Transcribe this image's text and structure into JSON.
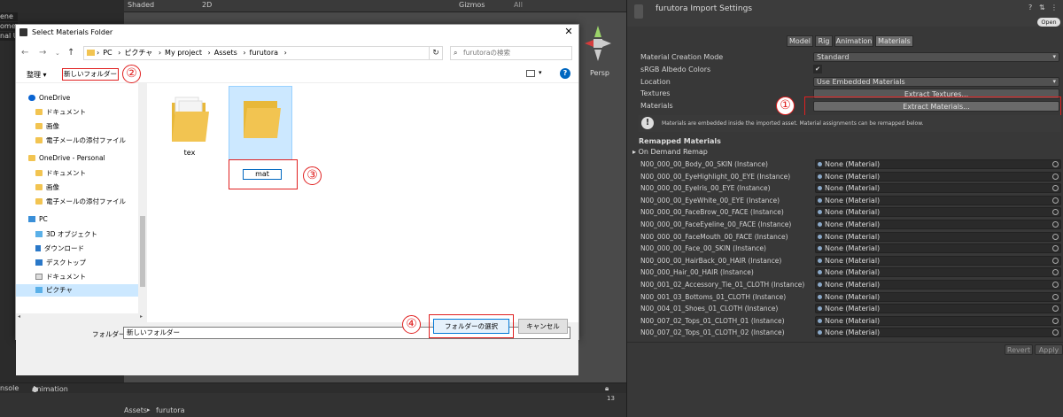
{
  "editor": {
    "hierarchy_fragments": [
      "ene",
      "omen",
      "nal U"
    ],
    "scene_toolbar": {
      "shading": "Shaded",
      "mode_2d": "2D",
      "gizmos": "Gizmos",
      "search_placeholder": "All"
    },
    "scene_persp": "Persp",
    "bottom_tabs": {
      "console": "nsole",
      "animation": "Animation"
    },
    "breadcrumb": {
      "root": "Assets",
      "sep": "▸",
      "folder": "furutora"
    },
    "layer_count": "13"
  },
  "inspector": {
    "title": "furutora Import Settings",
    "open_button": "Open",
    "tabs": [
      {
        "label": "Model",
        "active": false
      },
      {
        "label": "Rig",
        "active": false
      },
      {
        "label": "Animation",
        "active": false
      },
      {
        "label": "Materials",
        "active": true
      }
    ],
    "rows": {
      "creation_mode_label": "Material Creation Mode",
      "creation_mode_value": "Standard",
      "srgb_label": "sRGB Albedo Colors",
      "srgb_check": "✔",
      "location_label": "Location",
      "location_value": "Use Embedded Materials",
      "textures_label": "Textures",
      "textures_button": "Extract Textures...",
      "materials_label": "Materials",
      "materials_button": "Extract Materials..."
    },
    "info_text": "Materials are embedded inside the imported asset. Material assignments can be remapped below.",
    "remapped_header": "Remapped Materials",
    "on_demand": "On Demand Remap",
    "remap_value": "None (Material)",
    "remap_items": [
      "N00_000_00_Body_00_SKIN (Instance)",
      "N00_000_00_EyeHighlight_00_EYE (Instance)",
      "N00_000_00_EyeIris_00_EYE (Instance)",
      "N00_000_00_EyeWhite_00_EYE (Instance)",
      "N00_000_00_FaceBrow_00_FACE (Instance)",
      "N00_000_00_FaceEyeline_00_FACE (Instance)",
      "N00_000_00_FaceMouth_00_FACE (Instance)",
      "N00_000_00_Face_00_SKIN (Instance)",
      "N00_000_00_HairBack_00_HAIR (Instance)",
      "N00_000_Hair_00_HAIR (Instance)",
      "N00_001_02_Accessory_Tie_01_CLOTH (Instance)",
      "N00_001_03_Bottoms_01_CLOTH (Instance)",
      "N00_004_01_Shoes_01_CLOTH (Instance)",
      "N00_007_02_Tops_01_CLOTH_01 (Instance)",
      "N00_007_02_Tops_01_CLOTH_02 (Instance)"
    ],
    "revert_button": "Revert",
    "apply_button": "Apply"
  },
  "dialog": {
    "title": "Select Materials Folder",
    "path": [
      "PC",
      "ピクチャ",
      "My project",
      "Assets",
      "furutora"
    ],
    "search_placeholder": "furutoraの検索",
    "organize": "整理 ▾",
    "new_folder": "新しいフォルダー",
    "nav": {
      "onedrive": "OneDrive",
      "docs1": "ドキュメント",
      "pics1": "画像",
      "mail1": "電子メールの添付ファイル",
      "onedrive_personal": "OneDrive - Personal",
      "docs2": "ドキュメント",
      "pics2": "画像",
      "mail2": "電子メールの添付ファイル",
      "pc": "PC",
      "obj3d": "3D オブジェクト",
      "downloads": "ダウンロード",
      "desktop": "デスクトップ",
      "docs3": "ドキュメント",
      "pictures": "ピクチャ"
    },
    "folders": [
      {
        "name": "tex"
      },
      {
        "name": "mat"
      }
    ],
    "folder_label": "フォルダー:",
    "folder_value": "新しいフォルダー",
    "select_button": "フォルダーの選択",
    "cancel_button": "キャンセル"
  },
  "annotations": [
    "①",
    "②",
    "③",
    "④"
  ],
  "colors": {
    "annotation_red": "#e02020",
    "folder_yellow": "#f2c451",
    "selection_blue": "#cce8ff",
    "win_accent": "#0067c0"
  }
}
